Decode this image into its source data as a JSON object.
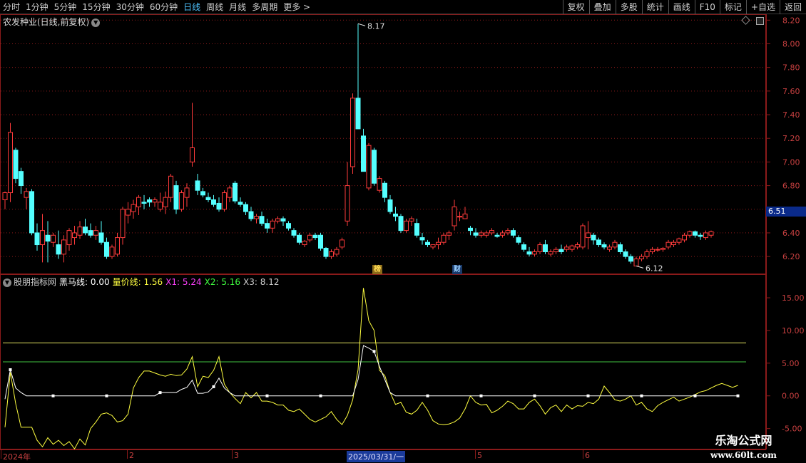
{
  "toolbar": {
    "periods": [
      "分时",
      "1分钟",
      "5分钟",
      "15分钟",
      "30分钟",
      "60分钟",
      "日线",
      "周线",
      "月线",
      "多周期",
      "更多 >"
    ],
    "active_period": "日线",
    "buttons": [
      "复权",
      "叠加",
      "多股",
      "统计",
      "画线",
      "F10",
      "标记",
      "+自选",
      "返回"
    ]
  },
  "stock": {
    "title": "农发种业(日线,前复权)",
    "current_price_label": "6.51",
    "high_label": "8.17",
    "low_label": "6.12"
  },
  "markers": {
    "bang": "榜",
    "cai": "财"
  },
  "indicator": {
    "name": "股朋指标网",
    "values": [
      {
        "label": "黑马线: 0.00",
        "color": "#ffffff"
      },
      {
        "label": "量价线: 1.56",
        "color": "#ffff40"
      },
      {
        "label": "X1: 5.24",
        "color": "#ff40ff"
      },
      {
        "label": "X2: 5.16",
        "color": "#40ff40"
      },
      {
        "label": "X3: 8.12",
        "color": "#d0d0d0"
      }
    ]
  },
  "date_axis": {
    "labels": [
      "2024年",
      "2",
      "3",
      "5",
      "6"
    ],
    "cursor_date": "2025/03/31/一"
  },
  "watermark": {
    "line1": "乐淘公式网",
    "line2": "www.60lt.com"
  },
  "colors": {
    "up": "#ff3b3b",
    "down": "#54ffff",
    "grid": "#8b1a1a",
    "axis_text": "#c84040"
  },
  "chart_data": [
    {
      "type": "candlestick",
      "title": "农发种业(日线,前复权)",
      "y_ticks": [
        "8.20",
        "8.00",
        "7.80",
        "7.60",
        "7.40",
        "7.20",
        "7.00",
        "6.80",
        "6.60",
        "6.40",
        "6.20"
      ],
      "ylim": [
        6.05,
        8.25
      ],
      "candles": [
        [
          6.68,
          6.75,
          6.6,
          6.74
        ],
        [
          6.74,
          7.33,
          6.66,
          7.25
        ],
        [
          7.1,
          7.12,
          6.82,
          6.86
        ],
        [
          6.92,
          6.95,
          6.73,
          6.8
        ],
        [
          6.7,
          6.78,
          6.6,
          6.75
        ],
        [
          6.75,
          6.77,
          6.38,
          6.4
        ],
        [
          6.4,
          6.48,
          6.25,
          6.3
        ],
        [
          6.3,
          6.56,
          6.15,
          6.42
        ],
        [
          6.38,
          6.5,
          6.15,
          6.33
        ],
        [
          6.32,
          6.4,
          6.28,
          6.38
        ],
        [
          6.3,
          6.42,
          6.18,
          6.22
        ],
        [
          6.22,
          6.38,
          6.15,
          6.34
        ],
        [
          6.3,
          6.44,
          6.25,
          6.42
        ],
        [
          6.36,
          6.46,
          6.3,
          6.4
        ],
        [
          6.38,
          6.5,
          6.35,
          6.45
        ],
        [
          6.45,
          6.52,
          6.38,
          6.4
        ],
        [
          6.42,
          6.48,
          6.36,
          6.38
        ],
        [
          6.38,
          6.46,
          6.34,
          6.42
        ],
        [
          6.4,
          6.5,
          6.3,
          6.32
        ],
        [
          6.32,
          6.36,
          6.18,
          6.2
        ],
        [
          6.2,
          6.3,
          6.18,
          6.28
        ],
        [
          6.22,
          6.4,
          6.2,
          6.36
        ],
        [
          6.36,
          6.62,
          6.3,
          6.6
        ],
        [
          6.55,
          6.66,
          6.48,
          6.6
        ],
        [
          6.58,
          6.68,
          6.52,
          6.64
        ],
        [
          6.62,
          6.72,
          6.55,
          6.7
        ],
        [
          6.66,
          6.72,
          6.6,
          6.65
        ],
        [
          6.68,
          6.7,
          6.62,
          6.66
        ],
        [
          6.66,
          6.7,
          6.62,
          6.68
        ],
        [
          6.6,
          6.74,
          6.58,
          6.66
        ],
        [
          6.62,
          6.75,
          6.56,
          6.7
        ],
        [
          6.7,
          6.9,
          6.66,
          6.88
        ],
        [
          6.8,
          6.84,
          6.56,
          6.6
        ],
        [
          6.6,
          6.76,
          6.58,
          6.74
        ],
        [
          6.7,
          6.82,
          6.62,
          6.78
        ],
        [
          7.0,
          7.5,
          6.96,
          7.12
        ],
        [
          6.84,
          6.9,
          6.72,
          6.76
        ],
        [
          6.75,
          6.78,
          6.7,
          6.72
        ],
        [
          6.7,
          6.74,
          6.66,
          6.68
        ],
        [
          6.68,
          6.72,
          6.62,
          6.64
        ],
        [
          6.65,
          6.7,
          6.58,
          6.6
        ],
        [
          6.6,
          6.76,
          6.58,
          6.74
        ],
        [
          6.7,
          6.8,
          6.66,
          6.78
        ],
        [
          6.82,
          6.84,
          6.65,
          6.67
        ],
        [
          6.66,
          6.7,
          6.62,
          6.64
        ],
        [
          6.64,
          6.66,
          6.55,
          6.58
        ],
        [
          6.58,
          6.62,
          6.5,
          6.52
        ],
        [
          6.52,
          6.56,
          6.48,
          6.54
        ],
        [
          6.54,
          6.58,
          6.46,
          6.48
        ],
        [
          6.48,
          6.52,
          6.4,
          6.44
        ],
        [
          6.44,
          6.52,
          6.4,
          6.5
        ],
        [
          6.5,
          6.54,
          6.48,
          6.52
        ],
        [
          6.52,
          6.54,
          6.46,
          6.5
        ],
        [
          6.48,
          6.5,
          6.42,
          6.44
        ],
        [
          6.42,
          6.44,
          6.36,
          6.38
        ],
        [
          6.38,
          6.4,
          6.3,
          6.32
        ],
        [
          6.3,
          6.34,
          6.28,
          6.33
        ],
        [
          6.34,
          6.4,
          6.32,
          6.38
        ],
        [
          6.38,
          6.4,
          6.34,
          6.36
        ],
        [
          6.38,
          6.4,
          6.25,
          6.27
        ],
        [
          6.27,
          6.28,
          6.18,
          6.2
        ],
        [
          6.2,
          6.26,
          6.18,
          6.24
        ],
        [
          6.22,
          6.28,
          6.2,
          6.26
        ],
        [
          6.28,
          6.36,
          6.26,
          6.34
        ],
        [
          6.5,
          7.0,
          6.46,
          6.8
        ],
        [
          6.96,
          7.58,
          6.9,
          7.54
        ],
        [
          7.54,
          8.17,
          7.28,
          7.28
        ],
        [
          7.22,
          7.28,
          6.92,
          6.92
        ],
        [
          6.78,
          7.16,
          6.76,
          7.14
        ],
        [
          7.1,
          7.12,
          6.8,
          6.82
        ],
        [
          6.76,
          6.88,
          6.74,
          6.86
        ],
        [
          6.82,
          6.84,
          6.66,
          6.7
        ],
        [
          6.68,
          6.72,
          6.56,
          6.58
        ],
        [
          6.56,
          6.62,
          6.5,
          6.54
        ],
        [
          6.54,
          6.56,
          6.4,
          6.42
        ],
        [
          6.42,
          6.52,
          6.4,
          6.5
        ],
        [
          6.5,
          6.54,
          6.46,
          6.52
        ],
        [
          6.48,
          6.52,
          6.36,
          6.38
        ],
        [
          6.36,
          6.4,
          6.3,
          6.34
        ],
        [
          6.32,
          6.34,
          6.28,
          6.3
        ],
        [
          6.28,
          6.3,
          6.26,
          6.3
        ],
        [
          6.3,
          6.36,
          6.26,
          6.32
        ],
        [
          6.32,
          6.4,
          6.3,
          6.38
        ],
        [
          6.38,
          6.42,
          6.34,
          6.4
        ],
        [
          6.46,
          6.68,
          6.42,
          6.62
        ],
        [
          6.54,
          6.58,
          6.5,
          6.54
        ],
        [
          6.52,
          6.62,
          6.52,
          6.56
        ],
        [
          6.44,
          6.46,
          6.38,
          6.42
        ],
        [
          6.4,
          6.44,
          6.36,
          6.38
        ],
        [
          6.38,
          6.42,
          6.36,
          6.4
        ],
        [
          6.38,
          6.42,
          6.36,
          6.4
        ],
        [
          6.4,
          6.44,
          6.38,
          6.42
        ],
        [
          6.38,
          6.4,
          6.36,
          6.37
        ],
        [
          6.38,
          6.42,
          6.36,
          6.4
        ],
        [
          6.4,
          6.44,
          6.38,
          6.42
        ],
        [
          6.42,
          6.44,
          6.36,
          6.38
        ],
        [
          6.36,
          6.38,
          6.3,
          6.32
        ],
        [
          6.3,
          6.32,
          6.24,
          6.26
        ],
        [
          6.24,
          6.28,
          6.2,
          6.22
        ],
        [
          6.22,
          6.26,
          6.2,
          6.24
        ],
        [
          6.24,
          6.32,
          6.22,
          6.3
        ],
        [
          6.3,
          6.34,
          6.22,
          6.24
        ],
        [
          6.22,
          6.26,
          6.2,
          6.24
        ],
        [
          6.24,
          6.28,
          6.22,
          6.26
        ],
        [
          6.26,
          6.3,
          6.22,
          6.24
        ],
        [
          6.26,
          6.3,
          6.24,
          6.28
        ],
        [
          6.26,
          6.3,
          6.24,
          6.29
        ],
        [
          6.28,
          6.32,
          6.26,
          6.3
        ],
        [
          6.28,
          6.48,
          6.26,
          6.46
        ],
        [
          6.36,
          6.5,
          6.26,
          6.4
        ],
        [
          6.38,
          6.4,
          6.3,
          6.34
        ],
        [
          6.34,
          6.36,
          6.28,
          6.3
        ],
        [
          6.3,
          6.32,
          6.26,
          6.28
        ],
        [
          6.26,
          6.3,
          6.24,
          6.28
        ],
        [
          6.28,
          6.34,
          6.26,
          6.32
        ],
        [
          6.3,
          6.32,
          6.22,
          6.24
        ],
        [
          6.24,
          6.26,
          6.18,
          6.2
        ],
        [
          6.2,
          6.22,
          6.14,
          6.16
        ],
        [
          6.12,
          6.2,
          6.12,
          6.18
        ],
        [
          6.18,
          6.22,
          6.16,
          6.2
        ],
        [
          6.2,
          6.26,
          6.18,
          6.24
        ],
        [
          6.24,
          6.28,
          6.22,
          6.26
        ],
        [
          6.26,
          6.28,
          6.24,
          6.26
        ],
        [
          6.26,
          6.28,
          6.24,
          6.27
        ],
        [
          6.28,
          6.34,
          6.26,
          6.32
        ],
        [
          6.3,
          6.34,
          6.28,
          6.32
        ],
        [
          6.32,
          6.36,
          6.3,
          6.35
        ],
        [
          6.34,
          6.4,
          6.32,
          6.38
        ],
        [
          6.38,
          6.42,
          6.36,
          6.41
        ],
        [
          6.41,
          6.42,
          6.36,
          6.38
        ],
        [
          6.38,
          6.4,
          6.34,
          6.37
        ],
        [
          6.36,
          6.42,
          6.34,
          6.4
        ],
        [
          6.38,
          6.42,
          6.36,
          6.41
        ]
      ]
    },
    {
      "type": "line",
      "title": "股朋指标网",
      "y_ticks": [
        "15.00",
        "10.00",
        "5.00",
        "0.00",
        "-5.00"
      ],
      "ylim": [
        -8.2,
        18.6
      ],
      "reference_lines": [
        {
          "value": 8.1,
          "color": "#e0e060"
        },
        {
          "value": 5.2,
          "color": "#40c040"
        }
      ],
      "series": [
        {
          "name": "量价线",
          "color": "#ffff40",
          "values": [
            -4.8,
            3.6,
            -1.2,
            -4.8,
            -4.8,
            -4.8,
            -6.8,
            -7.8,
            -6.4,
            -7.4,
            -6.8,
            -7.6,
            -7.0,
            -8.1,
            -6.6,
            -7.5,
            -5.0,
            -4.0,
            -2.8,
            -2.6,
            -3.0,
            -4.0,
            -3.8,
            -2.8,
            1.2,
            2.8,
            3.8,
            3.8,
            3.5,
            3.2,
            3.0,
            3.3,
            3.1,
            3.2,
            4.1,
            6.0,
            1.4,
            3.0,
            2.8,
            3.9,
            6.0,
            1.8,
            0.5,
            -0.4,
            -1.2,
            0.5,
            -0.3,
            0.5,
            -0.8,
            -0.8,
            -1.0,
            -1.4,
            -1.4,
            -2.2,
            -2.4,
            -2.0,
            -2.8,
            -3.6,
            -4.0,
            -3.6,
            -3.2,
            -2.4,
            -3.6,
            -4.4,
            -3.0,
            -0.6,
            4.0,
            16.5,
            11.5,
            10.0,
            3.9,
            3.1,
            0.5,
            -1.3,
            -1.0,
            -2.5,
            -2.8,
            -2.2,
            -1.0,
            -2.2,
            -3.8,
            -4.3,
            -4.4,
            -4.3,
            -4.0,
            -3.4,
            -2.0,
            0.0,
            -1.0,
            -1.4,
            -1.3,
            -2.6,
            -2.2,
            -1.6,
            -0.8,
            -1.2,
            -2.0,
            -2.0,
            -1.0,
            -0.5,
            -1.5,
            -2.8,
            -1.8,
            -1.4,
            -2.4,
            -1.4,
            -2.0,
            -1.5,
            -1.6,
            -1.0,
            -1.2,
            -0.5,
            1.5,
            0.5,
            -0.6,
            -0.8,
            -0.5,
            0.0,
            -1.4,
            -1.0,
            -2.0,
            -2.4,
            -1.5,
            -1.0,
            -0.6,
            -0.2,
            -0.8,
            -0.5,
            -0.2,
            0.2,
            0.6,
            0.8,
            1.2,
            1.6,
            1.9,
            1.6,
            1.3,
            1.6
          ]
        },
        {
          "name": "黑马线",
          "color": "#ffffff",
          "values": [
            -0.5,
            4.0,
            1.2,
            0.5,
            0.0,
            0.0,
            0.0,
            0.0,
            0.0,
            0.0,
            0.0,
            0.0,
            0.0,
            0.0,
            0.0,
            0.0,
            0.0,
            0.0,
            0.0,
            0.0,
            0.0,
            0.0,
            0.0,
            0.0,
            0.0,
            0.0,
            0.0,
            0.0,
            0.0,
            0.5,
            0.5,
            0.5,
            0.5,
            1.0,
            1.3,
            2.4,
            0.4,
            0.4,
            0.6,
            1.4,
            2.7,
            1.2,
            0.5,
            0.0,
            0.0,
            0.0,
            0.0,
            0.0,
            0.0,
            0.0,
            0.0,
            0.0,
            0.0,
            0.0,
            0.0,
            0.0,
            0.0,
            0.0,
            0.0,
            0.0,
            0.0,
            0.0,
            0.0,
            0.0,
            0.0,
            0.0,
            2.5,
            7.7,
            7.3,
            6.8,
            4.5,
            2.5,
            0.5,
            0.0,
            0.0,
            0.0,
            0.0,
            0.0,
            0.0,
            0.0,
            0.0,
            0.0,
            0.0,
            0.0,
            0.0,
            0.0,
            0.0,
            0.0,
            0.0,
            0.0,
            0.0,
            0.0,
            0.0,
            0.0,
            0.0,
            0.0,
            0.0,
            0.0,
            0.0,
            0.0,
            0.0,
            0.0,
            0.0,
            0.0,
            0.0,
            0.0,
            0.0,
            0.0,
            0.0,
            0.0,
            0.0,
            0.0,
            0.0,
            0.0,
            0.0,
            0.0,
            0.0,
            0.0,
            0.0,
            0.0,
            0.0,
            0.0,
            0.0,
            0.0,
            0.0,
            0.0,
            0.0,
            0.0,
            0.0,
            0.0,
            0.0,
            0.0,
            0.0,
            0.0,
            0.0,
            0.0,
            0.0,
            0.0
          ]
        }
      ],
      "marker_indices": [
        1,
        9,
        19,
        29,
        39,
        49,
        59,
        69,
        79,
        89,
        99,
        109,
        119,
        129,
        137
      ]
    }
  ]
}
